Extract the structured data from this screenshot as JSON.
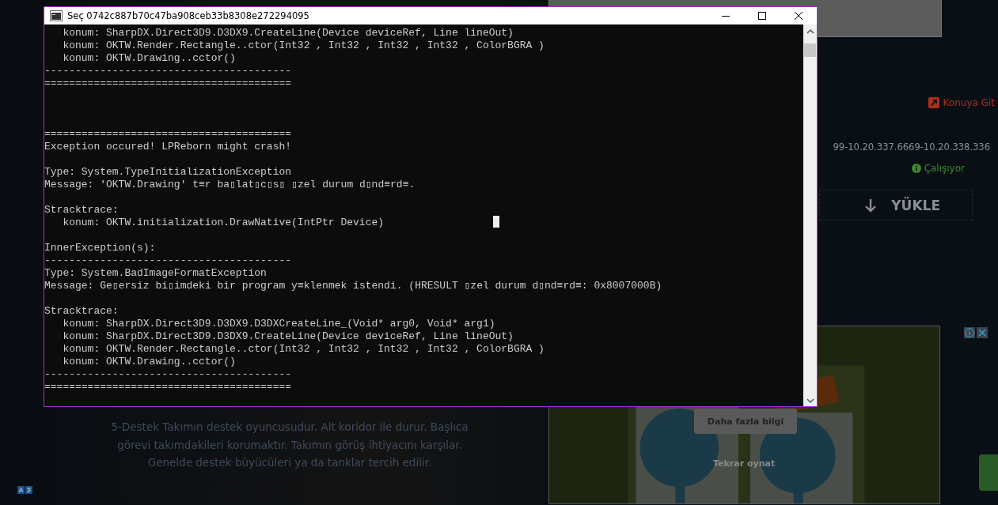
{
  "page": {
    "paragraph": "5-Destek Takımın destek oyuncusudur. Alt koridor ile durur. Başlıca görevi takımdakileri korumaktır. Takımın görüş ihtiyacını karşılar. Genelde destek büyücüleri ya da tanklar tercih edilir.",
    "link": "Konuya Git",
    "version": "99-10.20.337.6669-10.20.338.336",
    "status": "Çalışıyor",
    "download_button": "YÜKLE",
    "ad": {
      "kind": "picture",
      "more_info_button": "Daha fazla bilgi",
      "replay_label": "Tekrar oynat"
    }
  },
  "console": {
    "title": "Seç 0742c887b70c47ba908ceb33b8308e272294095",
    "lines": [
      {
        "kind": "text",
        "text": "   konum: SharpDX.Direct3D9.D3DX9.CreateLine(Device deviceRef, Line lineOut)"
      },
      {
        "kind": "text",
        "text": "   konum: OKTW.Render.Rectangle..ctor(Int32 , Int32 , Int32 , Int32 , ColorBGRA )"
      },
      {
        "kind": "text",
        "text": "   konum: OKTW.Drawing..cctor()"
      },
      {
        "kind": "text",
        "text": "----------------------------------------"
      },
      {
        "kind": "text",
        "text": "========================================"
      },
      {
        "kind": "blank"
      },
      {
        "kind": "blank"
      },
      {
        "kind": "blank"
      },
      {
        "kind": "text",
        "text": "========================================"
      },
      {
        "kind": "text",
        "text": "Exception occured! LPReborn might crash!"
      },
      {
        "kind": "blank"
      },
      {
        "kind": "text",
        "text": "Type: System.TypeInitializationException"
      },
      {
        "kind": "text",
        "text": "Message: 'OKTW.Drawing' t≡r ba▯lat▯c▯s▯ ▯zel durum d▯nd≡rd≡."
      },
      {
        "kind": "blank"
      },
      {
        "kind": "text",
        "text": "Stracktrace:"
      },
      {
        "kind": "text",
        "text": "   konum: OKTW.initialization.DrawNative(IntPtr Device)"
      },
      {
        "kind": "blank"
      },
      {
        "kind": "text",
        "text": "InnerException(s):"
      },
      {
        "kind": "text",
        "text": "----------------------------------------"
      },
      {
        "kind": "text",
        "text": "Type: System.BadImageFormatException"
      },
      {
        "kind": "text",
        "text": "Message: Ge▯ersiz bi▯imdeki bir program y≡klenmek istendi. (HRESULT ▯zel durum d▯nd≡rd≡: 0x8007000B)"
      },
      {
        "kind": "blank"
      },
      {
        "kind": "text",
        "text": "Stracktrace:"
      },
      {
        "kind": "text",
        "text": "   konum: SharpDX.Direct3D9.D3DX9.D3DXCreateLine_(Void* arg0, Void* arg1)"
      },
      {
        "kind": "text",
        "text": "   konum: SharpDX.Direct3D9.D3DX9.CreateLine(Device deviceRef, Line lineOut)"
      },
      {
        "kind": "text",
        "text": "   konum: OKTW.Render.Rectangle..ctor(Int32 , Int32 , Int32 , Int32 , ColorBGRA )"
      },
      {
        "kind": "text",
        "text": "   konum: OKTW.Drawing..cctor()"
      },
      {
        "kind": "text",
        "text": "----------------------------------------"
      },
      {
        "kind": "text",
        "text": "========================================"
      }
    ]
  }
}
